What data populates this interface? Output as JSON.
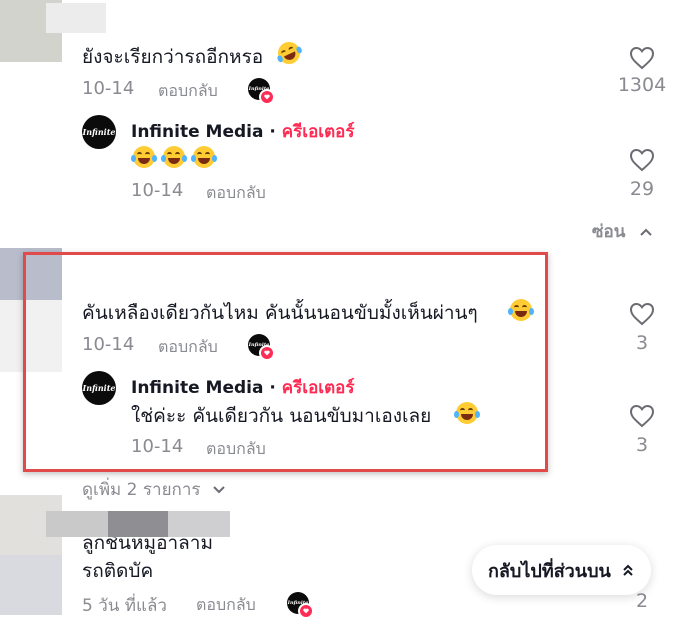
{
  "comments": [
    {
      "text": "ยังจะเรียกว่ารถอีกหรอ",
      "date": "10-14",
      "reply_label": "ตอบกลับ",
      "likes": "1304",
      "replies": [
        {
          "author": "Infinite Media",
          "separator": "·",
          "badge": "ครีเอเตอร์",
          "text": "",
          "date": "10-14",
          "reply_label": "ตอบกลับ",
          "likes": "29"
        }
      ],
      "hide_label": "ซ่อน"
    },
    {
      "text": "คันเหลืองเดียวกันไหม คันนั้นนอนขับมั้งเห็นผ่านๆ",
      "date": "10-14",
      "reply_label": "ตอบกลับ",
      "likes": "3",
      "replies": [
        {
          "author": "Infinite Media",
          "separator": "·",
          "badge": "ครีเอเตอร์",
          "text": "ใช่ค่ะะ คันเดียวกัน นอนขับมาเองเลย",
          "date": "10-14",
          "reply_label": "ตอบกลับ",
          "likes": "3"
        }
      ],
      "see_more_label": "ดูเพิ่ม 2 รายการ"
    },
    {
      "text_line1": "ลูกชิ้นหมูอาลาม",
      "text_line2": "รถติดบัค",
      "date": "5 วัน ที่แล้ว",
      "reply_label": "ตอบกลับ",
      "likes": "2"
    }
  ],
  "back_to_top_label": "กลับไปที่ส่วนบน",
  "avatar_logo_text": "Infinite",
  "colors": {
    "creator": "#fe2c55",
    "muted": "#8a8b91",
    "highlight": "#e04a4a"
  }
}
